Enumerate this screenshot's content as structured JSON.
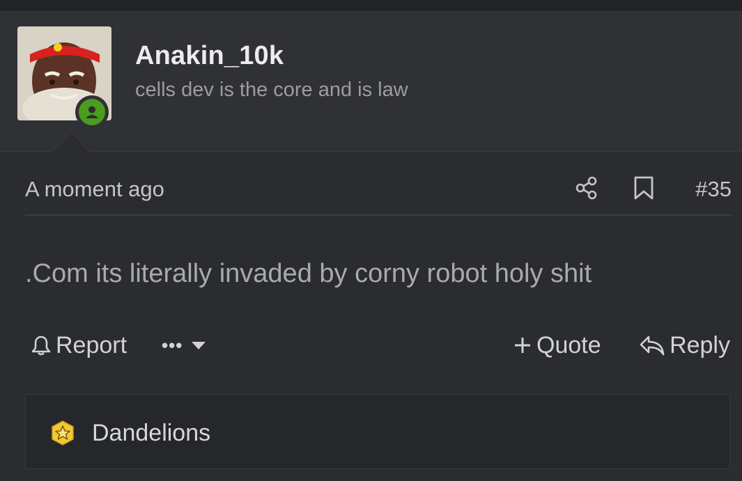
{
  "user": {
    "name": "Anakin_10k",
    "title": "cells dev is the core and is law",
    "avatar_icon": "user-avatar-photo",
    "online_icon": "online-user-icon",
    "online_color": "#4a9d1f"
  },
  "post": {
    "timestamp": "A moment ago",
    "number": "#35",
    "share_icon": "share-icon",
    "bookmark_icon": "bookmark-icon",
    "message": ".Com its literally invaded by corny robot holy shit"
  },
  "actions": {
    "report_label": "Report",
    "more_label": "•••",
    "quote_label": "Quote",
    "reply_label": "Reply"
  },
  "reactions": {
    "label": "Dandelions",
    "icon": "star-badge-icon",
    "icon_color": "#f3c836"
  },
  "colors": {
    "background": "#2b2c30",
    "user_block": "#303135",
    "reactions_bg": "#26272b"
  }
}
